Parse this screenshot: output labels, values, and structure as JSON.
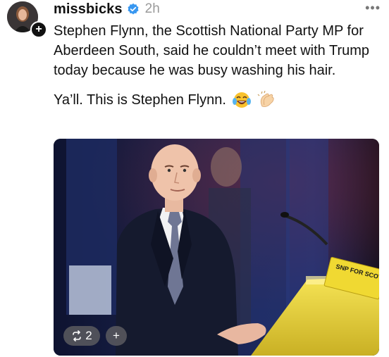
{
  "post": {
    "username": "missbicks",
    "time": "2h",
    "more_label": "•••",
    "text_paragraph_1": "Stephen Flynn, the Scottish National Party MP for Aberdeen South, said he couldn’t meet with Trump today because he was busy washing his hair.",
    "text_paragraph_2": "Ya’ll. This is Stephen Flynn.",
    "emojis": [
      "tears-of-joy-emoji",
      "clapping-hands-emoji"
    ]
  },
  "photo": {
    "podium_sign": "SNP FOR SCOTLAND",
    "repost_count": "2",
    "add_label": "+"
  },
  "colors": {
    "verified_blue": "#3897f0",
    "podium_yellow": "#f3de3a",
    "text": "#111111",
    "muted": "#9a9a9a"
  }
}
